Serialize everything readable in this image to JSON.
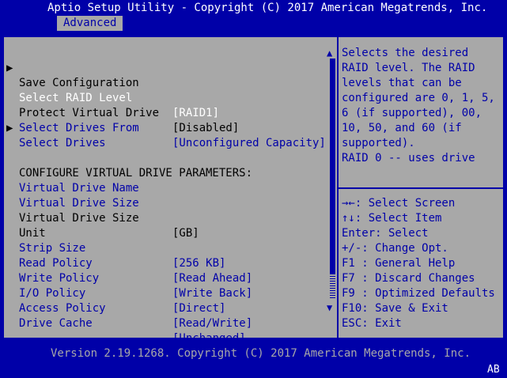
{
  "header": {
    "title": "Aptio Setup Utility - Copyright (C) 2017 American Megatrends, Inc.",
    "active_tab": "Advanced"
  },
  "menu": {
    "items": [
      {
        "arrow": "▶",
        "label": "Save Configuration",
        "value": "",
        "style": "black"
      },
      {
        "arrow": "",
        "label": "Select RAID Level",
        "value": "[RAID1]",
        "style": "white"
      },
      {
        "arrow": "",
        "label": "Protect Virtual Drive",
        "value": "[Disabled]",
        "style": "black"
      },
      {
        "arrow": "",
        "label": "Select Drives From",
        "value": "[Unconfigured Capacity]",
        "style": "blue"
      },
      {
        "arrow": "▶",
        "label": "Select Drives",
        "value": "",
        "style": "blue"
      },
      {
        "arrow": "",
        "label": "",
        "value": "",
        "style": "black"
      },
      {
        "arrow": "",
        "label": "CONFIGURE VIRTUAL DRIVE PARAMETERS:",
        "value": "",
        "style": "black"
      },
      {
        "arrow": "",
        "label": "Virtual Drive Name",
        "value": "",
        "style": "blue"
      },
      {
        "arrow": "",
        "label": "Virtual Drive Size",
        "value": "",
        "style": "blue"
      },
      {
        "arrow": "",
        "label": "Virtual Drive Size",
        "value": "[GB]",
        "style": "black"
      },
      {
        "arrow": "",
        "label": "Unit",
        "value": "",
        "style": "black"
      },
      {
        "arrow": "",
        "label": "Strip Size",
        "value": "[256 KB]",
        "style": "blue"
      },
      {
        "arrow": "",
        "label": "Read Policy",
        "value": "[Read Ahead]",
        "style": "blue"
      },
      {
        "arrow": "",
        "label": "Write Policy",
        "value": "[Write Back]",
        "style": "blue"
      },
      {
        "arrow": "",
        "label": "I/O Policy",
        "value": "[Direct]",
        "style": "blue"
      },
      {
        "arrow": "",
        "label": "Access Policy",
        "value": "[Read/Write]",
        "style": "blue"
      },
      {
        "arrow": "",
        "label": "Drive Cache",
        "value": "[Unchanged]",
        "style": "blue"
      }
    ]
  },
  "scrollbar": {
    "up": "▲",
    "down": "▼",
    "position_fraction": 0.0,
    "visible_fraction": 0.89
  },
  "help": {
    "lines": [
      "Selects the desired",
      "RAID level. The RAID",
      "levels that can be",
      "configured are 0, 1, 5,",
      "6 (if supported), 00,",
      "10, 50, and 60 (if",
      "supported).",
      "RAID 0 -- uses drive"
    ]
  },
  "keys": {
    "lines": [
      "→←: Select Screen",
      "↑↓: Select Item",
      "Enter: Select",
      "+/-: Change Opt.",
      "F1 : General Help",
      "F7 : Discard Changes",
      "F9 : Optimized Defaults",
      "F10: Save & Exit",
      "ESC: Exit"
    ]
  },
  "footer": {
    "version": "Version 2.19.1268. Copyright (C) 2017 American Megatrends, Inc.",
    "code": "AB"
  },
  "colors": {
    "background": "#0000a8",
    "panel": "#a8a8a8",
    "highlight_text": "#ffffff",
    "option_text": "#0000a8",
    "static_text": "#000000"
  }
}
